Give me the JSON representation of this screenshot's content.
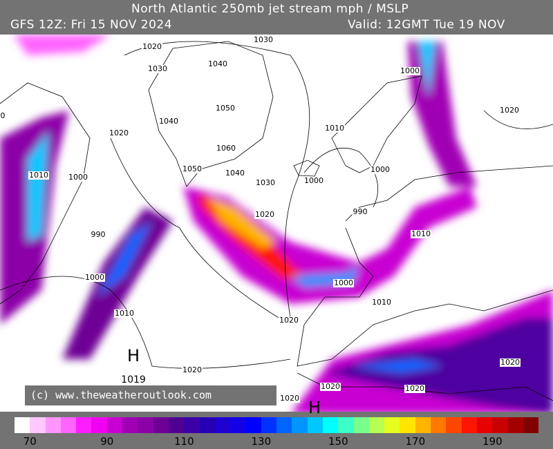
{
  "header": {
    "title": "North Atlantic 250mb jet stream mph / MSLP",
    "run": "GFS 12Z: Fri 15 NOV 2024",
    "valid": "Valid: 12GMT Tue 19 NOV"
  },
  "copyright": "(c) www.theweatheroutlook.com",
  "isobar_labels": [
    "1020",
    "1030",
    "1040",
    "1030",
    "1000",
    "1020",
    "1050",
    "1040",
    "1020",
    "1010",
    "1060",
    "1050",
    "1040",
    "1010",
    "1000",
    "1030",
    "1000",
    "1000",
    "990",
    "1020",
    "1010",
    "990",
    "1000",
    "1000",
    "1010",
    "1010",
    "1020",
    "1020",
    "1020",
    "1020",
    "1020",
    "1020",
    "0"
  ],
  "pressure_centres": [
    {
      "type": "H",
      "value": "1019"
    },
    {
      "type": "H",
      "value": ""
    }
  ],
  "colorbar": {
    "units": "mph",
    "start": 66,
    "step": 4,
    "tick_labels": [
      "70",
      "90",
      "110",
      "130",
      "150",
      "170",
      "190"
    ],
    "colors": [
      "#ffffff",
      "#ffc8ff",
      "#ff96ff",
      "#ff64ff",
      "#ff1eff",
      "#f000f0",
      "#c800d2",
      "#a000b4",
      "#8c00a8",
      "#6e0096",
      "#500090",
      "#3c00a8",
      "#2800b4",
      "#1e00d2",
      "#1400e6",
      "#0000ff",
      "#0032ff",
      "#0064ff",
      "#0096ff",
      "#00c8ff",
      "#00ffff",
      "#3cffc8",
      "#78ff8c",
      "#b4ff50",
      "#e6ff1e",
      "#ffe600",
      "#ffb400",
      "#ff7800",
      "#ff4600",
      "#ff1400",
      "#e60000",
      "#c80000",
      "#a50000",
      "#820000"
    ]
  }
}
